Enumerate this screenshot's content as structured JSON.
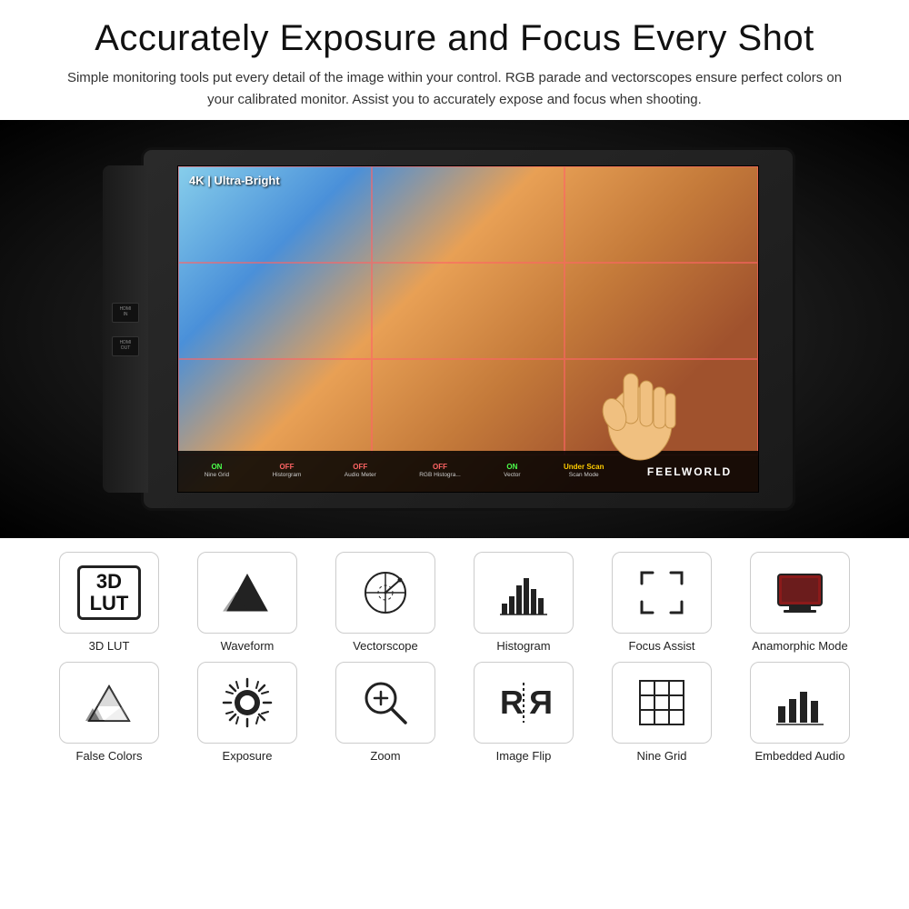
{
  "header": {
    "main_title": "Accurately Exposure and Focus Every Shot",
    "subtitle": "Simple monitoring tools put every detail of the image within your control. RGB parade and vectorscopes ensure perfect colors on your calibrated monitor. Assist you to accurately expose and focus when shooting."
  },
  "monitor": {
    "screen_label": "4K | Ultra-Bright",
    "brand": "FEELWORLD",
    "ports": [
      {
        "label": "HDMI\nIN"
      },
      {
        "label": "HDMI\nOUT"
      }
    ],
    "status_buttons": [
      {
        "status": "ON",
        "name": "Nine Grid",
        "color": "on"
      },
      {
        "status": "OFF",
        "name": "Historgram",
        "color": "off"
      },
      {
        "status": "OFF",
        "name": "Audio Meter",
        "color": "off"
      },
      {
        "status": "OFF",
        "name": "RGB Histogra...",
        "color": "off"
      },
      {
        "status": "ON",
        "name": "Vector",
        "color": "on"
      },
      {
        "status": "Under Scan\nScan Mode",
        "name": "",
        "color": "on2"
      }
    ]
  },
  "features": {
    "row1": [
      {
        "id": "3d-lut",
        "label": "3D LUT",
        "icon": "lut"
      },
      {
        "id": "waveform",
        "label": "Waveform",
        "icon": "waveform"
      },
      {
        "id": "vectorscope",
        "label": "Vectorscope",
        "icon": "vectorscope"
      },
      {
        "id": "histogram",
        "label": "Histogram",
        "icon": "histogram"
      },
      {
        "id": "focus-assist",
        "label": "Focus Assist",
        "icon": "focus-assist"
      },
      {
        "id": "anamorphic-mode",
        "label": "Anamorphic Mode",
        "icon": "anamorphic"
      }
    ],
    "row2": [
      {
        "id": "false-colors",
        "label": "False Colors",
        "icon": "false-colors"
      },
      {
        "id": "exposure",
        "label": "Exposure",
        "icon": "exposure"
      },
      {
        "id": "zoom",
        "label": "Zoom",
        "icon": "zoom"
      },
      {
        "id": "image-flip",
        "label": "Image Flip",
        "icon": "image-flip"
      },
      {
        "id": "nine-grid",
        "label": "Nine Grid",
        "icon": "nine-grid"
      },
      {
        "id": "embedded-audio",
        "label": "Embedded Audio",
        "icon": "embedded-audio"
      }
    ]
  }
}
